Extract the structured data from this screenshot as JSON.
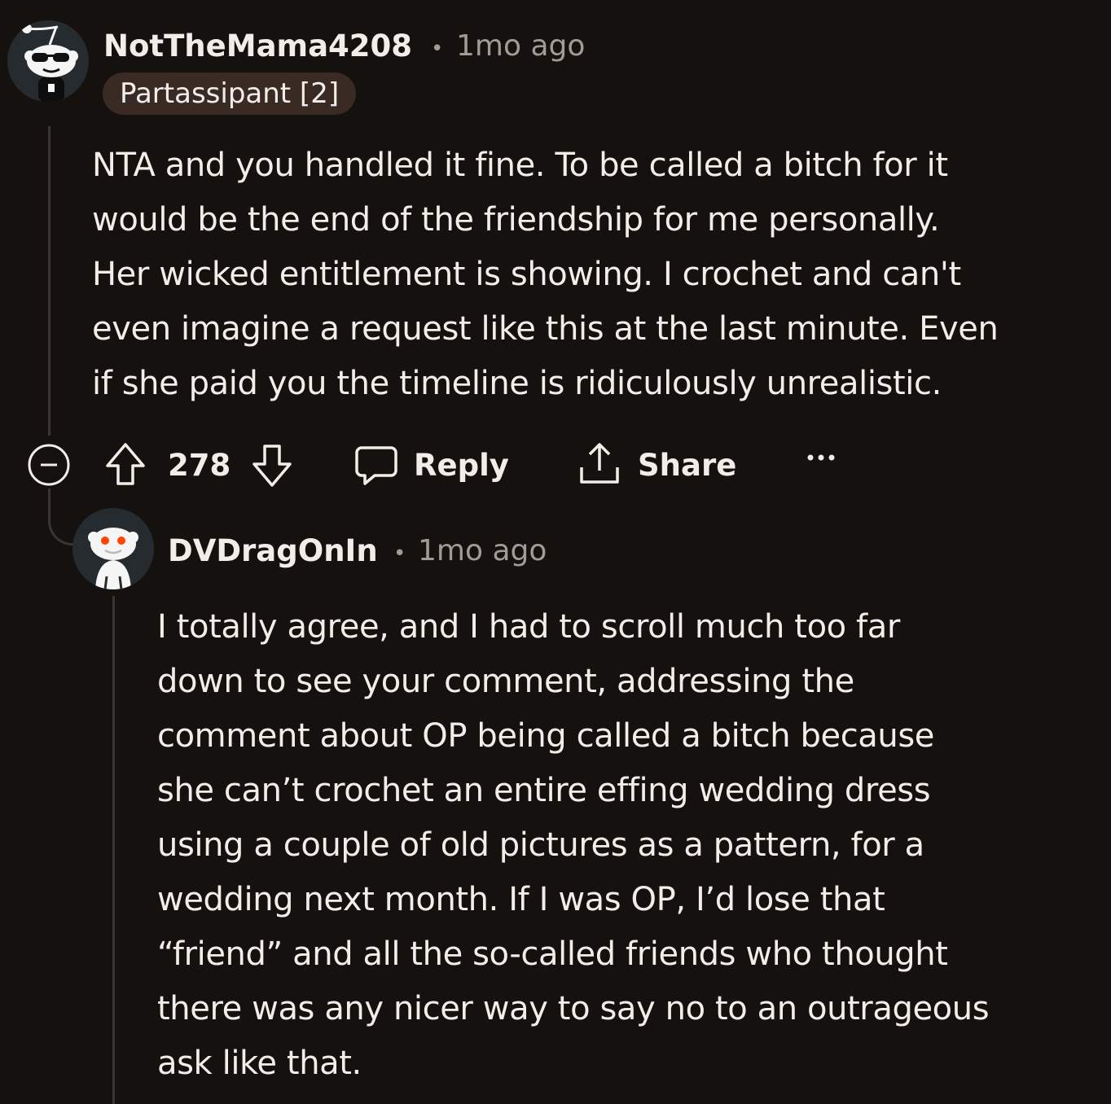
{
  "comments": [
    {
      "username": "NotTheMama4208",
      "separator": "•",
      "timestamp": "1mo ago",
      "flair": "Partassipant [2]",
      "avatar_icon": "snoo-sunglasses-avatar",
      "body_lines": [
        "NTA and you handled it fine. To be called a bitch for it",
        "would be the end of the friendship for me personally.",
        "Her wicked entitlement is showing. I crochet and can't",
        "even imagine a request like this at the last minute. Even",
        "if she paid you the timeline is ridiculously unrealistic."
      ]
    },
    {
      "username": "DVDragOnIn",
      "separator": "•",
      "timestamp": "1mo ago",
      "avatar_icon": "snoo-default-avatar",
      "body_lines": [
        "I totally agree, and I had to scroll much too far",
        "down to see your comment, addressing the",
        "comment about OP being called a bitch because",
        "she can’t crochet an entire effing wedding dress",
        "using a couple of old pictures as a pattern, for a",
        "wedding next month. If I was OP, I’d lose that",
        "“friend” and all the so-called friends who thought",
        "there was any nicer way to say no to an outrageous",
        "ask like that."
      ]
    }
  ],
  "actions": {
    "score": "278",
    "reply_label": "Reply",
    "share_label": "Share",
    "icons": {
      "collapse": "collapse-minus-icon",
      "upvote": "upvote-arrow-icon",
      "downvote": "downvote-arrow-icon",
      "reply": "speech-bubble-icon",
      "share": "share-icon",
      "more": "more-dots-icon"
    }
  },
  "colors": {
    "background": "#15110f",
    "text": "#f2ede9",
    "muted": "#a39c96",
    "flair_bg": "#3a2a24",
    "thread_line": "#3a3532"
  }
}
